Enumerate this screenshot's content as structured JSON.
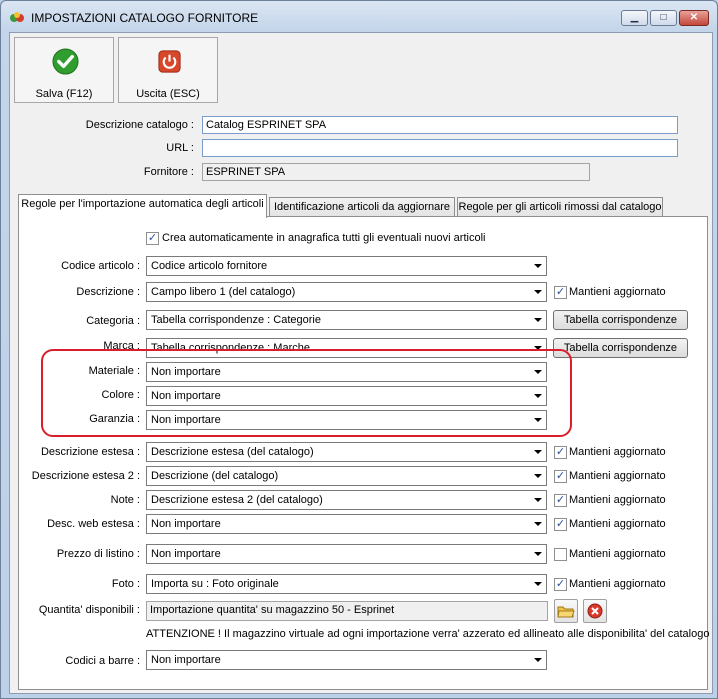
{
  "window": {
    "title": "IMPOSTAZIONI CATALOGO FORNITORE",
    "minimize": "▁",
    "maximize": "□",
    "close": "✕"
  },
  "toolbar": {
    "save_label": "Salva (F12)",
    "exit_label": "Uscita (ESC)"
  },
  "header_form": {
    "descrizione_label": "Descrizione catalogo :",
    "descrizione_value": "Catalog ESPRINET SPA",
    "url_label": "URL :",
    "url_value": "",
    "fornitore_label": "Fornitore :",
    "fornitore_value": "ESPRINET SPA"
  },
  "tabs": [
    {
      "label": "Regole per l'importazione automatica degli articoli",
      "active": true
    },
    {
      "label": "Identificazione articoli da aggiornare",
      "active": false
    },
    {
      "label": "Regole per gli articoli rimossi dal catalogo",
      "active": false
    }
  ],
  "auto_create": {
    "checked": true,
    "label": "Crea automaticamente in anagrafica tutti gli eventuali nuovi articoli"
  },
  "rows": {
    "codice_articolo": {
      "label": "Codice articolo :",
      "value": "Codice articolo fornitore"
    },
    "descrizione": {
      "label": "Descrizione :",
      "value": "Campo libero 1 (del catalogo)",
      "keep": true
    },
    "categoria": {
      "label": "Categoria :",
      "value": "Tabella corrispondenze : Categorie"
    },
    "marca": {
      "label": "Marca :",
      "value": "Tabella corrispondenze : Marche"
    },
    "materiale": {
      "label": "Materiale :",
      "value": "Non importare"
    },
    "colore": {
      "label": "Colore :",
      "value": "Non importare"
    },
    "garanzia": {
      "label": "Garanzia :",
      "value": "Non importare"
    },
    "descrizione_estesa": {
      "label": "Descrizione estesa :",
      "value": "Descrizione estesa (del catalogo)",
      "keep": true
    },
    "descrizione_estesa_2": {
      "label": "Descrizione estesa 2 :",
      "value": "Descrizione (del catalogo)",
      "keep": true
    },
    "note": {
      "label": "Note :",
      "value": "Descrizione estesa 2 (del catalogo)",
      "keep": true
    },
    "desc_web": {
      "label": "Desc. web estesa :",
      "value": "Non importare",
      "keep": true
    },
    "prezzo": {
      "label": "Prezzo di listino :",
      "value": "Non importare",
      "keep": false
    },
    "foto": {
      "label": "Foto :",
      "value": "Importa su : Foto originale",
      "keep": true
    },
    "quantita": {
      "label": "Quantita' disponibili :",
      "value": "Importazione quantita' su magazzino 50 - Esprinet"
    },
    "codici_barre": {
      "label": "Codici a barre :",
      "value": "Non importare"
    }
  },
  "keep_label": "Mantieni aggiornato",
  "table_button_label": "Tabella corrispondenze",
  "notice": "ATTENZIONE ! Il magazzino virtuale ad ogni importazione verra' azzerato ed allineato alle disponibilita' del catalogo",
  "colors": {
    "highlight": "#d81f2b",
    "save_green": "#2f9e2f",
    "exit_red": "#d9472b"
  }
}
